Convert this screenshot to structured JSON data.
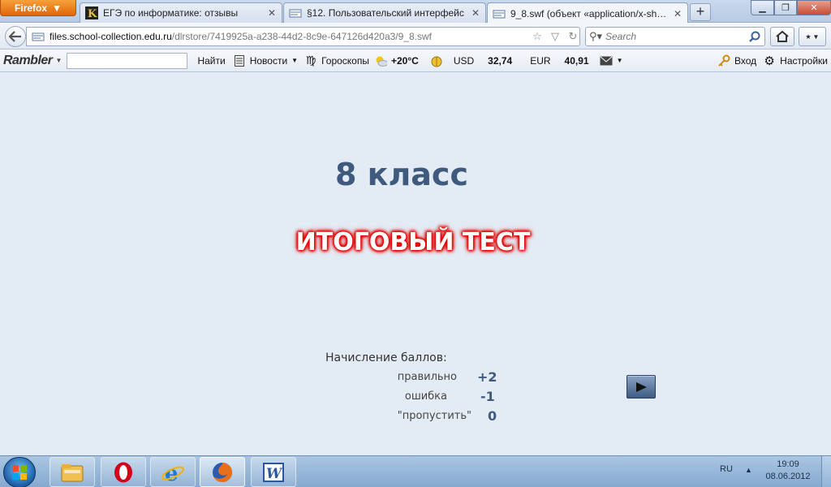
{
  "browser": {
    "firefox_label": "Firefox",
    "tabs": [
      {
        "title": "ЕГЭ по информатике: отзывы",
        "icon": "k-site-icon"
      },
      {
        "title": "§12. Пользовательский интерфейс",
        "icon": "page-icon"
      },
      {
        "title": "9_8.swf (объект «application/x-shock...",
        "icon": "page-icon"
      }
    ],
    "url_domain": "files.school-collection.edu.ru",
    "url_path": "/dlrstore/7419925a-a238-44d2-8c9e-647126d420a3/9_8.swf",
    "search_placeholder": "Search"
  },
  "rambler": {
    "logo": "Rambler",
    "search_button": "Найти",
    "news": "Новости",
    "horoscopes": "Гороскопы",
    "temperature": "+20°C",
    "usd_label": "USD",
    "usd_value": "32,74",
    "eur_label": "EUR",
    "eur_value": "40,91",
    "login": "Вход",
    "settings": "Настройки"
  },
  "content": {
    "grade_title": "8 класс",
    "test_title": "ИТОГОВЫЙ ТЕСТ",
    "scoring_title": "Начисление баллов:",
    "scoring": [
      {
        "label": "правильно",
        "value": "+2"
      },
      {
        "label": "ошибка",
        "value": "-1"
      },
      {
        "label": "\"пропустить\"",
        "value": "0"
      }
    ]
  },
  "taskbar": {
    "apps": [
      "explorer-icon",
      "opera-icon",
      "ie-icon",
      "firefox-icon",
      "word-icon"
    ],
    "language": "RU",
    "time": "19:09",
    "date": "08.06.2012"
  },
  "colors": {
    "title_blue": "#3f5a7d",
    "test_glow": "#e00000",
    "content_bg": "#e3ecf5"
  }
}
